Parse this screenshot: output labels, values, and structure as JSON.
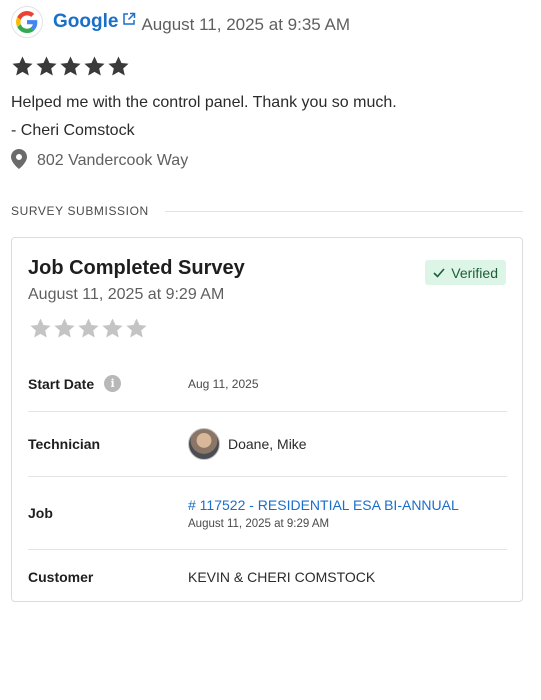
{
  "review": {
    "source": "Google",
    "date": "August 11, 2025 at 9:35 AM",
    "rating": 5,
    "text": "Helped me with the control panel.  Thank you so much.",
    "author": "- Cheri Comstock",
    "location": "802 Vandercook Way",
    "icons": [
      "google-logo-icon",
      "external-link-icon",
      "star-icon",
      "map-pin-icon"
    ]
  },
  "survey_section": {
    "title": "SURVEY SUBMISSION"
  },
  "survey_card": {
    "title": "Job Completed Survey",
    "date": "August 11, 2025 at 9:29 AM",
    "badge": "Verified",
    "rating": 0,
    "rows": {
      "start_date": {
        "label": "Start Date",
        "value": "Aug 11, 2025",
        "info_icon": "i"
      },
      "technician": {
        "label": "Technician",
        "value": "Doane, Mike"
      },
      "job": {
        "label": "Job",
        "link": "# 117522 - RESIDENTIAL ESA BI-ANNUAL",
        "date": "August 11, 2025 at 9:29 AM"
      },
      "customer": {
        "label": "Customer",
        "value": "KEVIN & CHERI COMSTOCK"
      }
    }
  },
  "colors": {
    "link": "#1a6fc9",
    "star_filled": "#3a3a3a",
    "star_empty": "#c4c4c4",
    "badge_bg": "#dcf5e6",
    "badge_text": "#1f5d3a"
  }
}
